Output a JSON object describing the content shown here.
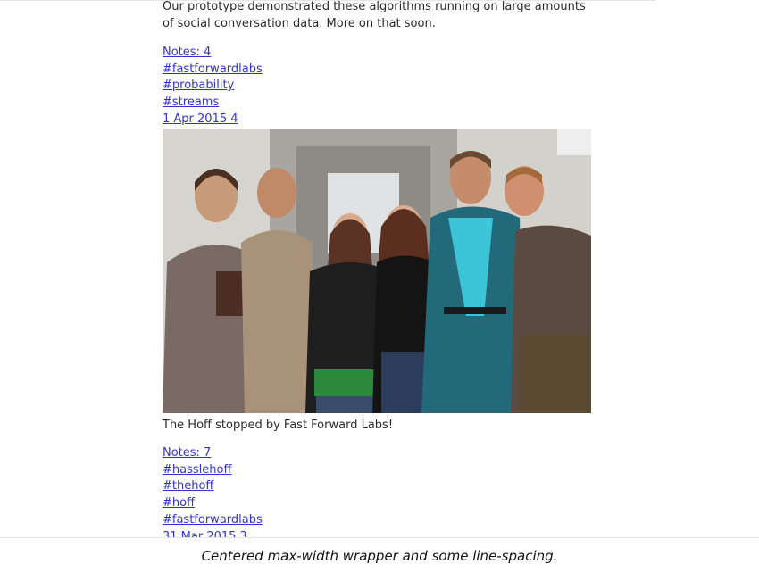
{
  "post1": {
    "text": "Our prototype demonstrated these algorithms running on large amounts of social conversation data. More on that soon.",
    "notes": "Notes: 4",
    "tags": [
      "#fastforwardlabs",
      "#probability",
      "#streams"
    ],
    "date": "1 Apr 2015 4"
  },
  "post2": {
    "photo_alt": "Group photo",
    "caption": "The Hoff stopped by Fast Forward Labs!",
    "notes": "Notes: 7",
    "tags": [
      "#hasslehoff",
      "#thehoff",
      "#hoff",
      "#fastforwardlabs"
    ],
    "date": "31 Mar 2015 3"
  },
  "footer_caption": "Centered max-width wrapper and some line-spacing."
}
